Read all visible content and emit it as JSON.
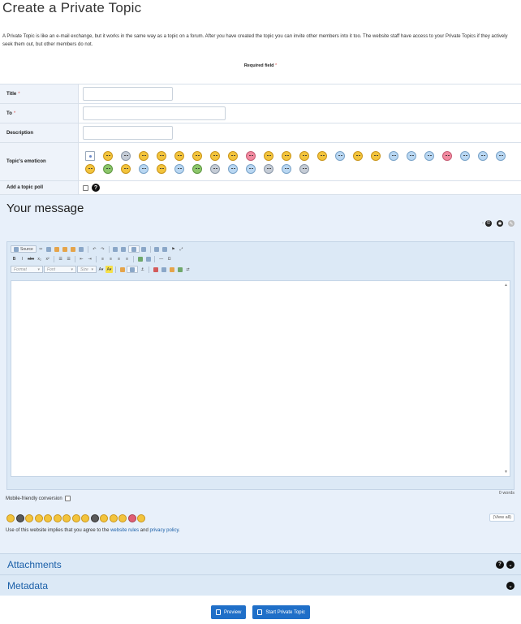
{
  "page": {
    "title": "Create a Private Topic",
    "intro": "A Private Topic is like an e-mail exchange, but it works in the same way as a topic on a forum. After you have created the topic you can invite other members into it too. The website staff have access to your Private Topics if they actively seek them out, but other members do not.",
    "required_note": "Required field",
    "required_star": "*"
  },
  "form": {
    "title_label": "Title",
    "to_label": "To",
    "description_label": "Description",
    "emoticon_label": "Topic's emoticon",
    "poll_label": "Add a topic poll"
  },
  "message": {
    "heading": "Your message",
    "word_count": "0 words",
    "mobile_conversion_label": "Mobile-friendly conversion",
    "view_all": "(View all)",
    "agree_prefix": "Use of this website implies that you agree to the",
    "website_rules": "website rules",
    "and": "and",
    "privacy_policy": "privacy policy",
    "agree_suffix": "."
  },
  "editor": {
    "source_label": "Source",
    "format_label": "Format",
    "font_label": "Font",
    "size_label": "Size"
  },
  "sections": {
    "attachments": "Attachments",
    "metadata": "Metadata"
  },
  "actions": {
    "preview": "Preview",
    "start": "Start Private Topic"
  }
}
